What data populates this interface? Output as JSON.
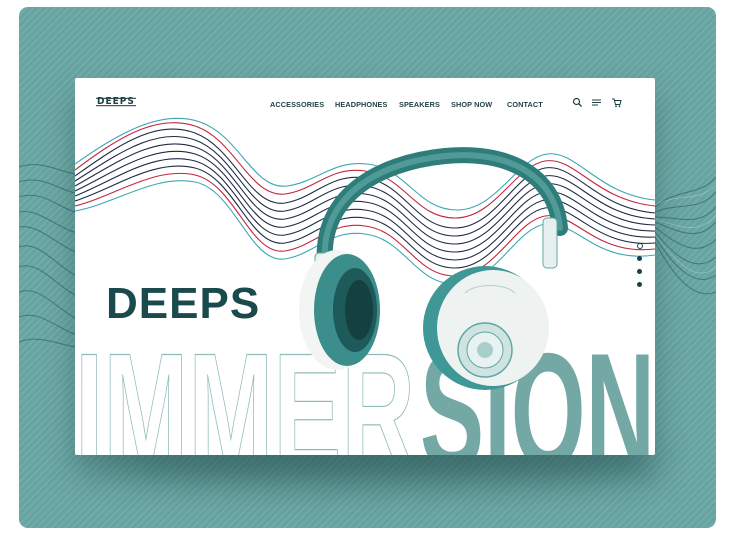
{
  "brand": {
    "logo": "DEEPS",
    "accent": "#6aa8a5",
    "dark": "#1f3f43",
    "wave_red": "#c2273b",
    "wave_navy": "#1f2b45"
  },
  "nav": {
    "items": [
      {
        "label": "ACCESSORIES"
      },
      {
        "label": "HEADPHONES"
      },
      {
        "label": "SPEAKERS"
      },
      {
        "label": "SHOP NOW"
      },
      {
        "label": "CONTACT"
      }
    ],
    "icons": [
      "search-icon",
      "menu-icon",
      "cart-icon"
    ]
  },
  "hero": {
    "title": "DEEPS",
    "word_outline": "IMMER",
    "word_solid": "SION",
    "image": "teal-over-ear-headphones"
  },
  "slider": {
    "count": 4,
    "active_index": 0
  }
}
